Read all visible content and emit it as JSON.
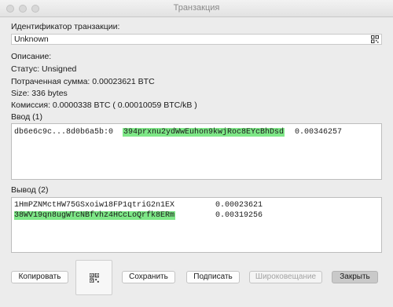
{
  "window": {
    "title": "Транзакция"
  },
  "transaction": {
    "id_label": "Идентификатор транзакции:",
    "id_value": "Unknown",
    "description_label": "Описание:",
    "status": "Статус: Unsigned",
    "spent": "Потраченная сумма: 0.00023621 BTC",
    "size": "Size: 336 bytes",
    "fee": "Комиссия: 0.0000338 BTC  ( 0.00010059 BTC/kB )"
  },
  "inputs": {
    "label": "Ввод (1)",
    "rows": [
      {
        "prevout": "db6e6c9c...8d0b6a5b:0",
        "address": "394prxnu2ydWwEuhon9kwjRoc8EYcBhDsd",
        "amount": "0.00346257"
      }
    ]
  },
  "outputs": {
    "label": "Вывод (2)",
    "rows": [
      {
        "address": "1HmPZNMctHW75GSxoiw18FP1qtriG2n1EX",
        "amount": "0.00023621",
        "highlight": false
      },
      {
        "address": "38WV19qn8ugWTcNBfvhz4HCcLoQrfk8ERm",
        "amount": "0.00319256",
        "highlight": true
      }
    ]
  },
  "buttons": {
    "copy": "Копировать",
    "save": "Сохранить",
    "sign": "Подписать",
    "broadcast": "Широковещание",
    "close": "Закрыть"
  },
  "icons": {
    "qr_small": "qr-code-icon",
    "qr_large": "qr-code-icon"
  },
  "colors": {
    "highlight": "#7ee787"
  }
}
